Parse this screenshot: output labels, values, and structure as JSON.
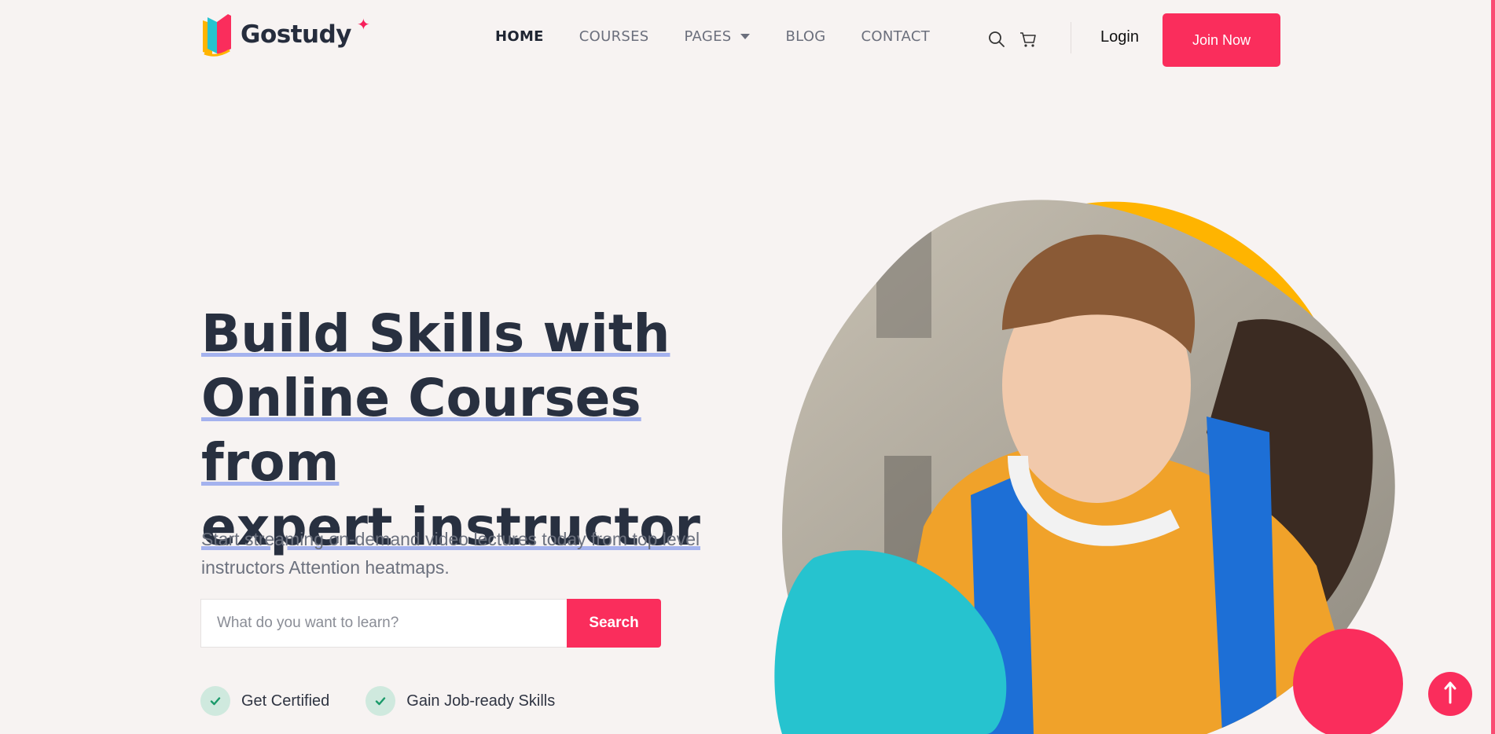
{
  "brand": {
    "name": "Gostudy",
    "star": "✦"
  },
  "nav": {
    "items": [
      {
        "label": "HOME",
        "active": true
      },
      {
        "label": "COURSES",
        "active": false
      },
      {
        "label": "PAGES",
        "active": false,
        "dropdown": true
      },
      {
        "label": "BLOG",
        "active": false
      },
      {
        "label": "CONTACT",
        "active": false
      }
    ]
  },
  "header_actions": {
    "search_icon": "search-icon",
    "cart_icon": "cart-icon",
    "login_label": "Login",
    "join_label": "Join Now"
  },
  "hero": {
    "title_lines": [
      "Build Skills with",
      "Online Courses from",
      "expert instructor"
    ],
    "subtitle": "Start streaming on-demand video lectures today from top level instructors Attention heatmaps.",
    "search": {
      "placeholder": "What do you want to learn?",
      "value": "",
      "button_label": "Search"
    },
    "features": [
      "Get Certified",
      "Gain Job-ready Skills"
    ]
  },
  "colors": {
    "accent": "#fa2d5c",
    "yellow": "#ffb400",
    "teal": "#26c3cf",
    "heading": "#283040",
    "underline": "#a4b2ee",
    "background": "#f7f3f2"
  },
  "scroll_top_icon": "arrow-up-icon"
}
